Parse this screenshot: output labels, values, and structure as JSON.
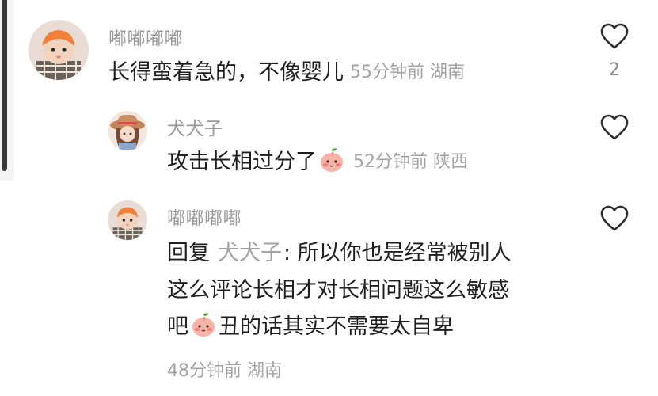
{
  "comments": [
    {
      "user": "嘟嘟嘟嘟",
      "text": "长得蛮着急的，不像婴儿",
      "time": "55分钟前",
      "location": "湖南",
      "likes": "2",
      "avatar_icon": "baby-orange-hat-avatar"
    },
    {
      "user": "犬犬子",
      "text": "攻击长相过分了",
      "emoji": "peach-blush-emoji",
      "time": "52分钟前",
      "location": "陕西",
      "likes": "",
      "avatar_icon": "cartoon-girl-hat-avatar"
    },
    {
      "user": "嘟嘟嘟嘟",
      "reply_prefix": "回复",
      "reply_to": "犬犬子",
      "reply_line1": ": 所以你也是经常被别人",
      "reply_line2": "这么评论长相才对长相问题这么敏感",
      "reply_line3a": "吧",
      "reply_line3b": "丑的话其实不需要太自卑",
      "emoji": "peach-blush-emoji",
      "time": "48分钟前",
      "location": "湖南",
      "likes": "",
      "avatar_icon": "baby-orange-hat-avatar"
    }
  ],
  "colors": {
    "username": "#9a9a9a",
    "meta": "#a3a3a3",
    "text": "#1f1f1f",
    "icon": "#2f2f2f"
  }
}
